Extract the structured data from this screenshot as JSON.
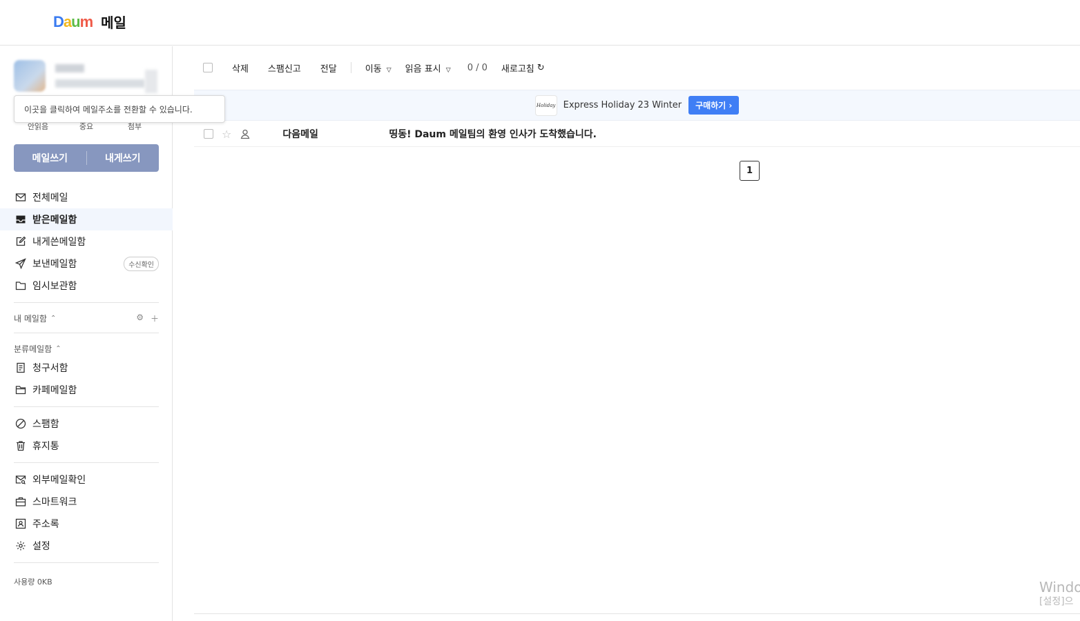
{
  "header": {
    "logo_text": "Daum",
    "service_name": "메일"
  },
  "tooltip": {
    "text": "이곳을 클릭하여 메일주소를 전환할 수 있습니다."
  },
  "quick_filters": [
    "안읽음",
    "중요",
    "첨부"
  ],
  "write": {
    "compose": "메일쓰기",
    "to_self": "내게쓰기"
  },
  "nav": {
    "all": "전체메일",
    "inbox": "받은메일함",
    "self_sent": "내게쓴메일함",
    "sent": "보낸메일함",
    "sent_badge": "수신확인",
    "drafts": "임시보관함"
  },
  "my_folders": {
    "title": "내 메일함"
  },
  "categories": {
    "title": "분류메일함",
    "invoices": "청구서함",
    "cafe": "카페메일함"
  },
  "spam_trash": {
    "spam": "스팸함",
    "trash": "휴지통"
  },
  "tools": {
    "external": "외부메일확인",
    "smartwork": "스마트워크",
    "contacts": "주소록",
    "settings": "설정"
  },
  "usage": "사용량 0KB",
  "toolbar": {
    "delete": "삭제",
    "spam": "스팸신고",
    "forward": "전달",
    "move": "이동",
    "mark_read": "읽음 표시",
    "count": "0 / 0",
    "refresh": "새로고침"
  },
  "banner": {
    "thumb_text": "Holiday",
    "text": "Express Holiday 23 Winter",
    "button": "구매하기 ›"
  },
  "mails": [
    {
      "sender": "다음메일",
      "subject": "띵동! Daum 메일팀의 환영 인사가 도착했습니다."
    }
  ],
  "pagination": {
    "current": "1"
  },
  "watermark": {
    "line1": "Windo",
    "line2": "[설정]으"
  },
  "colors": {
    "write_button": "#8797bf",
    "buy_button": "#3f7ef5",
    "active_bg": "#f2f6fd"
  }
}
